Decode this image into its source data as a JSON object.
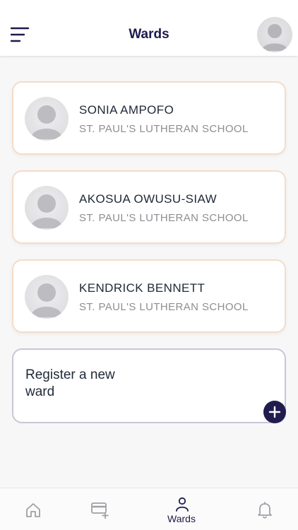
{
  "header": {
    "title": "Wards",
    "menu_icon": "menu-icon",
    "profile_icon": "avatar"
  },
  "wards": [
    {
      "name": "SONIA AMPOFO",
      "school": "ST. PAUL'S LUTHERAN SCHOOL"
    },
    {
      "name": "AKOSUA OWUSU-SIAW",
      "school": "ST. PAUL'S LUTHERAN SCHOOL"
    },
    {
      "name": "KENDRICK BENNETT",
      "school": "ST. PAUL'S LUTHERAN SCHOOL"
    }
  ],
  "register": {
    "label": "Register a new ward",
    "add_icon": "plus-icon"
  },
  "tabbar": {
    "tabs": [
      {
        "icon": "home-icon",
        "label": "",
        "active": false
      },
      {
        "icon": "card-add-icon",
        "label": "",
        "active": false
      },
      {
        "icon": "person-icon",
        "label": "Wards",
        "active": true
      },
      {
        "icon": "bell-icon",
        "label": "",
        "active": false
      }
    ]
  },
  "colors": {
    "accent": "#211c4e",
    "card_border": "#f5dcc8",
    "register_border": "#c9c6d8",
    "secondary_text": "#8e8e93",
    "inactive_icon": "#a0a0a8"
  }
}
